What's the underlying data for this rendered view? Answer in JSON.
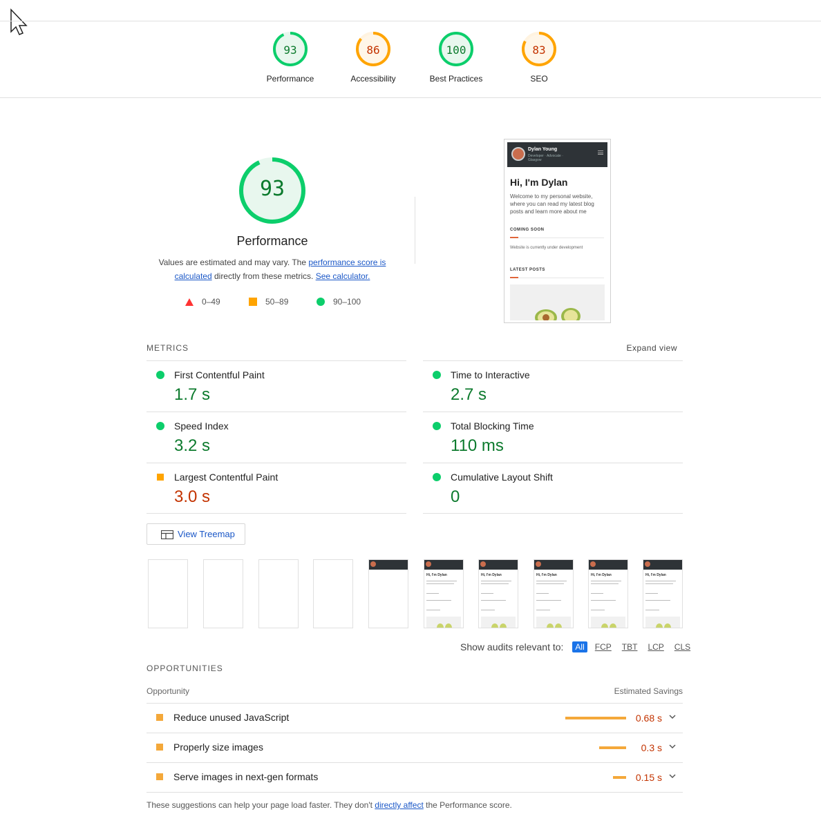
{
  "colors": {
    "pass": "#0cce6b",
    "pass_text": "#0c7a2d",
    "average": "#ffa400",
    "average_text": "#c33300",
    "fail": "#ff4e42",
    "link": "#1a57c7"
  },
  "gauges": [
    {
      "score": "93",
      "label": "Performance",
      "value": 0.93,
      "rating": "pass"
    },
    {
      "score": "86",
      "label": "Accessibility",
      "value": 0.86,
      "rating": "average"
    },
    {
      "score": "100",
      "label": "Best Practices",
      "value": 1.0,
      "rating": "pass"
    },
    {
      "score": "83",
      "label": "SEO",
      "value": 0.83,
      "rating": "average"
    }
  ],
  "performance": {
    "score": "93",
    "score_value": 0.93,
    "title": "Performance",
    "desc_prefix": "Values are estimated and may vary. The ",
    "link1": "performance score is calculated",
    "desc_middle": " directly from these metrics. ",
    "link2": "See calculator.",
    "legend": [
      {
        "icon": "triangle-icon",
        "range": "0–49"
      },
      {
        "icon": "square-icon",
        "range": "50–89"
      },
      {
        "icon": "circle-icon",
        "range": "90–100"
      }
    ]
  },
  "screenshot": {
    "name": "Dylan Young",
    "subtitle": "Developer · Advocate · Glasgow",
    "heading": "Hi, I'm Dylan",
    "paragraph": "Welcome to my personal website, where you can read my latest blog posts and learn more about me",
    "section1": "COMING SOON",
    "note": "Website is currently under development",
    "section2": "LATEST POSTS"
  },
  "metrics": {
    "title": "METRICS",
    "expand": "Expand view",
    "items": [
      {
        "name": "First Contentful Paint",
        "value": "1.7 s",
        "rating": "pass",
        "icon": "circle-icon"
      },
      {
        "name": "Time to Interactive",
        "value": "2.7 s",
        "rating": "pass",
        "icon": "circle-icon"
      },
      {
        "name": "Speed Index",
        "value": "3.2 s",
        "rating": "pass",
        "icon": "circle-icon"
      },
      {
        "name": "Total Blocking Time",
        "value": "110 ms",
        "rating": "pass",
        "icon": "circle-icon"
      },
      {
        "name": "Largest Contentful Paint",
        "value": "3.0 s",
        "rating": "average",
        "icon": "square-icon"
      },
      {
        "name": "Cumulative Layout Shift",
        "value": "0",
        "rating": "pass",
        "icon": "circle-icon"
      }
    ]
  },
  "treemap": {
    "label": "View Treemap",
    "icon": "treemap-icon"
  },
  "filmstrip": {
    "frames": 10,
    "blank_frames": 4
  },
  "filter": {
    "label": "Show audits relevant to:",
    "chips": [
      "All",
      "FCP",
      "TBT",
      "LCP",
      "CLS"
    ],
    "active": "All"
  },
  "opportunities": {
    "title": "OPPORTUNITIES",
    "col_left": "Opportunity",
    "col_right": "Estimated Savings",
    "items": [
      {
        "name": "Reduce unused JavaScript",
        "savings": "0.68 s",
        "bar_fraction": 1.0
      },
      {
        "name": "Properly size images",
        "savings": "0.3 s",
        "bar_fraction": 0.44
      },
      {
        "name": "Serve images in next-gen formats",
        "savings": "0.15 s",
        "bar_fraction": 0.22
      }
    ]
  },
  "footer": {
    "prefix": "These suggestions can help your page load faster. They don't ",
    "link": "directly affect",
    "suffix": " the Performance score."
  }
}
